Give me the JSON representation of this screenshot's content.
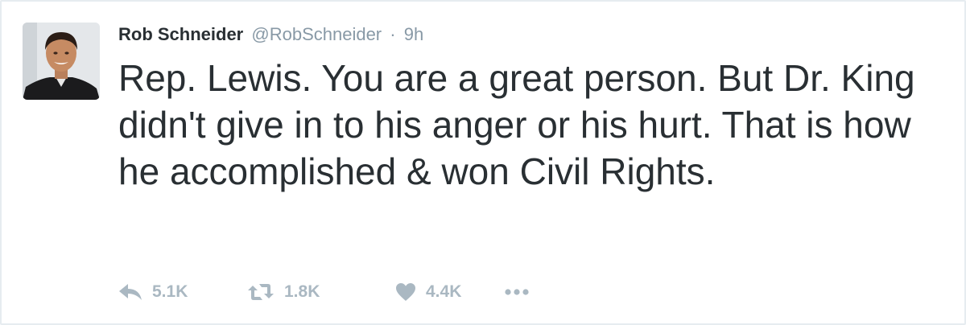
{
  "tweet": {
    "author_name": "Rob Schneider",
    "handle": "@RobSchneider",
    "separator": "·",
    "timestamp": "9h",
    "text": "Rep. Lewis. You are a great person. But Dr. King didn't give in to his anger or his hurt. That is how he accomplished & won Civil Rights.",
    "avatar_icon": "profile-photo"
  },
  "actions": {
    "reply": {
      "icon": "reply-icon",
      "count": "5.1K"
    },
    "retweet": {
      "icon": "retweet-icon",
      "count": "1.8K"
    },
    "like": {
      "icon": "heart-icon",
      "count": "4.4K"
    },
    "more": {
      "icon": "more-dots-icon"
    }
  },
  "colors": {
    "text": "#292f33",
    "secondary": "#8899a6",
    "action_icons": "#aab8c2",
    "border": "#e6ecf0"
  }
}
